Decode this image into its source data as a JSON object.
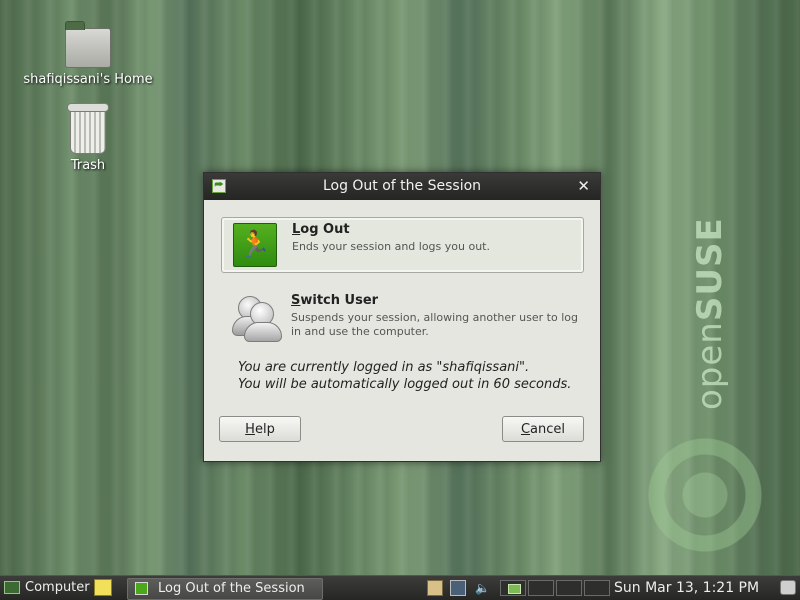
{
  "desktop": {
    "home_label": "shafiqissani's Home",
    "trash_label": "Trash",
    "brand_light": "open",
    "brand_bold": "SUSE"
  },
  "dialog": {
    "title": "Log Out of the Session",
    "close_glyph": "✕",
    "logout": {
      "title_first": "L",
      "title_rest": "og Out",
      "description": "Ends your session and logs you out."
    },
    "switch_user": {
      "title_first": "S",
      "title_rest": "witch User",
      "description": "Suspends your session, allowing another user to log in and use the computer."
    },
    "info_line1": "You are currently logged in as \"shafiqissani\".",
    "info_line2": "You will be automatically logged out in 60 seconds.",
    "help_first": "H",
    "help_rest": "elp",
    "cancel_first": "C",
    "cancel_rest": "ancel"
  },
  "taskbar": {
    "computer_label": "Computer",
    "task_label": "Log Out of the Session",
    "clock": "Sun Mar 13,  1:21 PM"
  },
  "icons": {
    "exit": "exit-icon",
    "users": "users-icon",
    "folder": "home-folder-icon",
    "trash": "trash-icon"
  },
  "colors": {
    "accent_green": "#4ca81b",
    "dialog_bg": "#e6e6e1",
    "titlebar_bg": "#2f2f2e"
  }
}
